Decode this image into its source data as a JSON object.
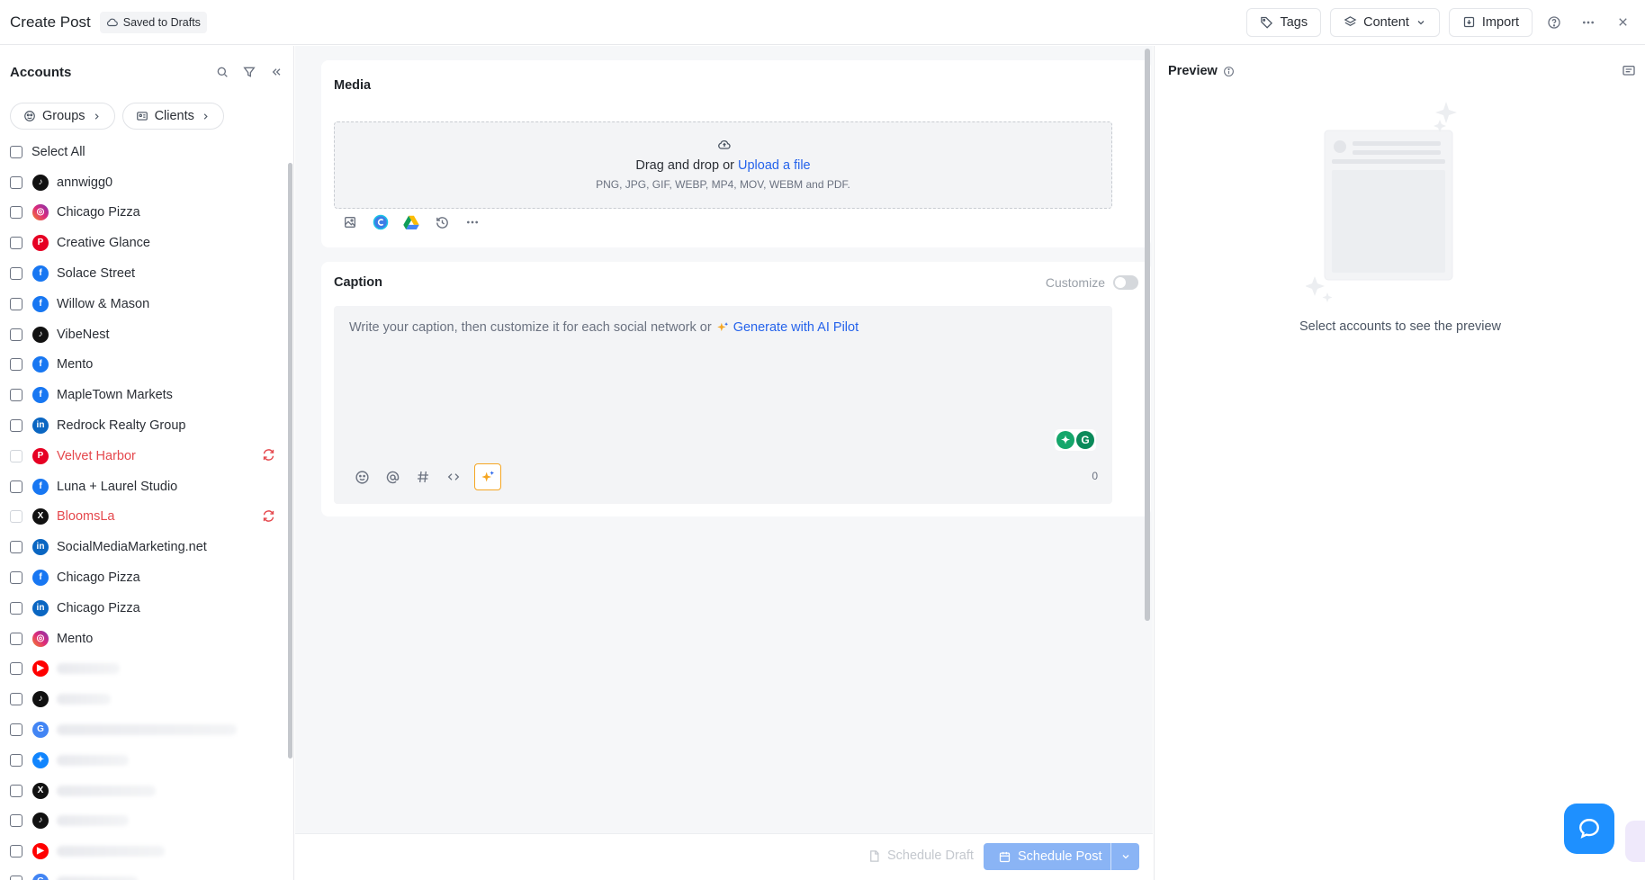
{
  "header": {
    "title": "Create Post",
    "draft_status": "Saved to Drafts",
    "tags_label": "Tags",
    "content_label": "Content",
    "import_label": "Import"
  },
  "sidebar": {
    "title": "Accounts",
    "groups_label": "Groups",
    "clients_label": "Clients",
    "select_all": "Select All",
    "accounts": [
      {
        "name": "annwigg0",
        "network": "tiktok"
      },
      {
        "name": "Chicago Pizza",
        "network": "instagram"
      },
      {
        "name": "Creative Glance",
        "network": "pinterest"
      },
      {
        "name": "Solace Street",
        "network": "facebook"
      },
      {
        "name": "Willow & Mason",
        "network": "facebook"
      },
      {
        "name": "VibeNest",
        "network": "tiktok"
      },
      {
        "name": "Mento",
        "network": "facebook"
      },
      {
        "name": "MapleTown Markets",
        "network": "facebook"
      },
      {
        "name": "Redrock Realty Group",
        "network": "linkedin"
      },
      {
        "name": "Velvet Harbor",
        "network": "pinterest",
        "error": true
      },
      {
        "name": "Luna + Laurel Studio",
        "network": "facebook"
      },
      {
        "name": "BloomsLa",
        "network": "x",
        "error": true
      },
      {
        "name": "SocialMediaMarketing.net",
        "network": "linkedin"
      },
      {
        "name": "Chicago Pizza",
        "network": "facebook"
      },
      {
        "name": "Chicago Pizza",
        "network": "linkedin"
      },
      {
        "name": "Mento",
        "network": "instagram"
      }
    ],
    "blurred_accounts": [
      "youtube",
      "tiktok",
      "google",
      "bluesky",
      "x",
      "tiktok",
      "youtube",
      "google"
    ]
  },
  "media": {
    "title": "Media",
    "drop_text": "Drag and drop or",
    "upload_link": "Upload a file",
    "formats": "PNG, JPG, GIF, WEBP, MP4, MOV, WEBM and PDF."
  },
  "caption": {
    "title": "Caption",
    "customize_label": "Customize",
    "placeholder": "Write your caption, then customize it for each social network or",
    "ai_link": "Generate with AI Pilot",
    "char_count": "0"
  },
  "footer": {
    "schedule_draft": "Schedule Draft",
    "schedule_post": "Schedule Post"
  },
  "preview": {
    "title": "Preview",
    "empty_message": "Select accounts to see the preview"
  },
  "colors": {
    "accent": "#2563eb",
    "error": "#e5484d",
    "schedule_disabled": "#8ab4f5",
    "help": "#1e90ff"
  }
}
